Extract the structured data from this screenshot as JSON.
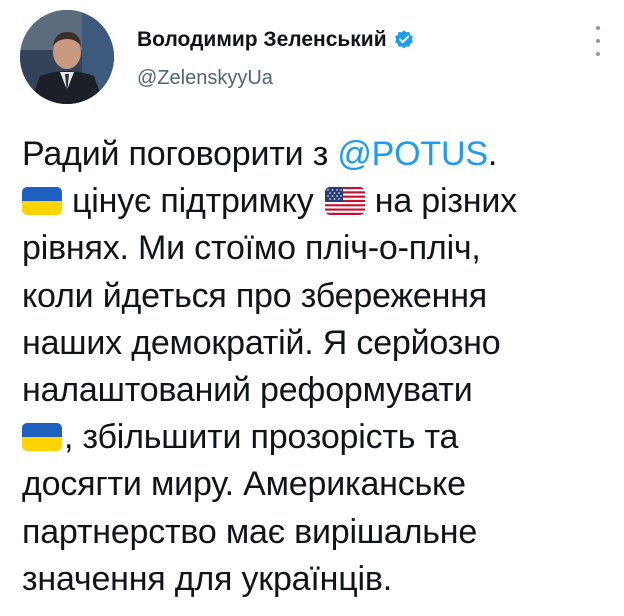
{
  "author": {
    "name": "Володимир Зеленський",
    "handle": "@ZelenskyyUa",
    "verified": true
  },
  "tweet": {
    "lines": [
      {
        "before": "Радий поговорити з ",
        "mention": "@POTUS",
        "after": "."
      },
      {
        "flag_ua": true,
        "text1": "цінує підтримку ",
        "flag_us": true,
        "text2": "на різних"
      },
      {
        "text": "рівнях. Ми стоїмо пліч-о-пліч,"
      },
      {
        "text": "коли йдеться про збереження"
      },
      {
        "text": "наших демократій. Я серйозно"
      },
      {
        "text": "налаштований реформувати"
      },
      {
        "flag_ua": true,
        "text": ", збільшити прозорість та"
      },
      {
        "text": "досягти миру. Американське"
      },
      {
        "text": "партнерство має вирішальне"
      },
      {
        "text": "значення для українців."
      }
    ]
  },
  "colors": {
    "mention": "#1d9bf0",
    "verified_badge": "#1d9bf0",
    "handle": "#536471",
    "ua_blue": "#1f5fbf",
    "ua_yellow": "#ffd400"
  },
  "icons": {
    "verified": "verified-badge-icon",
    "more": "more-options-icon",
    "flag_ua": "ukraine-flag-icon",
    "flag_us": "us-flag-icon"
  }
}
